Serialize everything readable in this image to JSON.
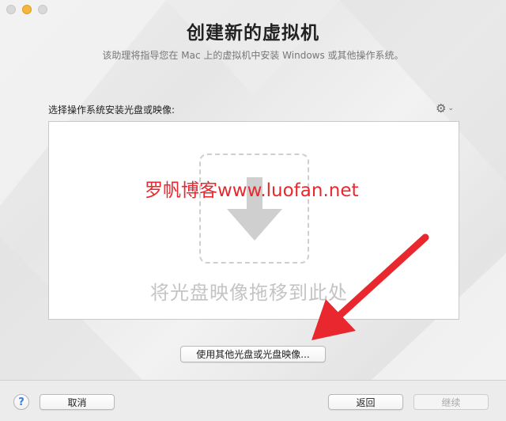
{
  "window": {
    "title": "创建新的虚拟机",
    "subtitle": "该助理将指导您在 Mac 上的虚拟机中安装 Windows 或其他操作系统。"
  },
  "content": {
    "section_label": "选择操作系统安装光盘或映像:",
    "gear_icon": "gear-icon",
    "drop_hint": "将光盘映像拖移到此处",
    "watermark": "罗帆博客www.luofan.net",
    "other_media_button": "使用其他光盘或光盘映像..."
  },
  "footer": {
    "help_label": "?",
    "cancel_label": "取消",
    "back_label": "返回",
    "continue_label": "继续"
  },
  "colors": {
    "annotation_arrow": "#e8282e",
    "watermark": "#e8282e",
    "help_accent": "#3a7be0"
  }
}
